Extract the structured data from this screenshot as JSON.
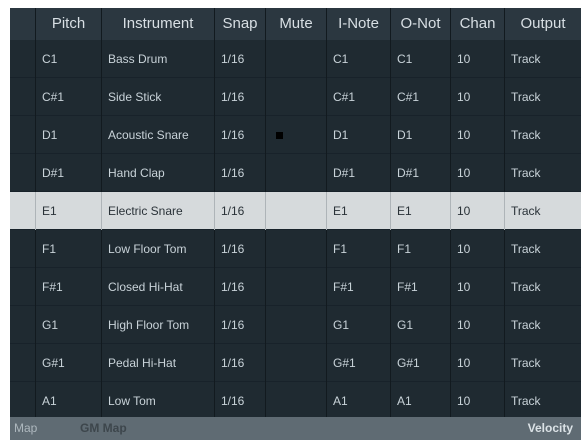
{
  "columns": {
    "pitch": "Pitch",
    "instrument": "Instrument",
    "snap": "Snap",
    "mute": "Mute",
    "inote": "I-Note",
    "onote": "O-Not",
    "chan": "Chan",
    "output": "Output"
  },
  "rows": [
    {
      "pitch": "C1",
      "instrument": "Bass Drum",
      "snap": "1/16",
      "mute": false,
      "inote": "C1",
      "onote": "C1",
      "chan": "10",
      "output": "Track"
    },
    {
      "pitch": "C#1",
      "instrument": "Side Stick",
      "snap": "1/16",
      "mute": false,
      "inote": "C#1",
      "onote": "C#1",
      "chan": "10",
      "output": "Track"
    },
    {
      "pitch": "D1",
      "instrument": "Acoustic Snare",
      "snap": "1/16",
      "mute": true,
      "inote": "D1",
      "onote": "D1",
      "chan": "10",
      "output": "Track"
    },
    {
      "pitch": "D#1",
      "instrument": "Hand Clap",
      "snap": "1/16",
      "mute": false,
      "inote": "D#1",
      "onote": "D#1",
      "chan": "10",
      "output": "Track"
    },
    {
      "pitch": "E1",
      "instrument": "Electric Snare",
      "snap": "1/16",
      "mute": false,
      "inote": "E1",
      "onote": "E1",
      "chan": "10",
      "output": "Track",
      "selected": true
    },
    {
      "pitch": "F1",
      "instrument": "Low Floor Tom",
      "snap": "1/16",
      "mute": false,
      "inote": "F1",
      "onote": "F1",
      "chan": "10",
      "output": "Track"
    },
    {
      "pitch": "F#1",
      "instrument": "Closed Hi-Hat",
      "snap": "1/16",
      "mute": false,
      "inote": "F#1",
      "onote": "F#1",
      "chan": "10",
      "output": "Track"
    },
    {
      "pitch": "G1",
      "instrument": "High Floor Tom",
      "snap": "1/16",
      "mute": false,
      "inote": "G1",
      "onote": "G1",
      "chan": "10",
      "output": "Track"
    },
    {
      "pitch": "G#1",
      "instrument": "Pedal Hi-Hat",
      "snap": "1/16",
      "mute": false,
      "inote": "G#1",
      "onote": "G#1",
      "chan": "10",
      "output": "Track"
    },
    {
      "pitch": "A1",
      "instrument": "Low Tom",
      "snap": "1/16",
      "mute": false,
      "inote": "A1",
      "onote": "A1",
      "chan": "10",
      "output": "Track"
    }
  ],
  "footer": {
    "map_label": "Map",
    "map_value": "GM Map",
    "velocity_label": "Velocity"
  },
  "colors": {
    "background": "#1f2a31",
    "header": "#2b3740",
    "selected_row": "#d6dadc",
    "footer": "#5f6b73"
  }
}
